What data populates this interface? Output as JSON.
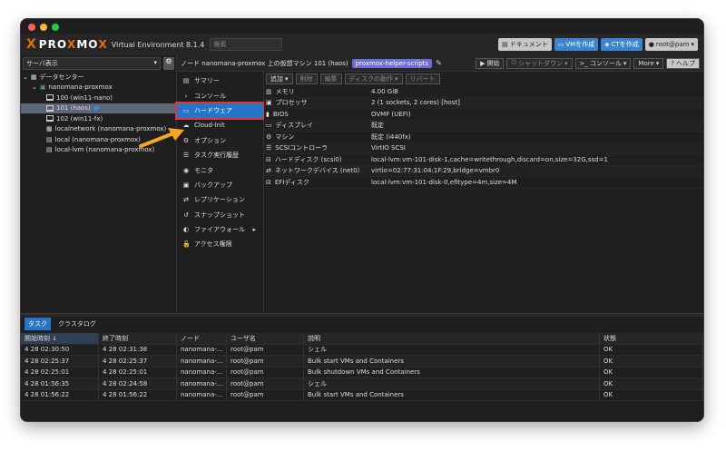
{
  "topbar": {
    "brand_x": "X",
    "brand_pro": "PRO",
    "brand_x2": "X",
    "brand_mo": "MO",
    "brand_x3": "X",
    "version": "Virtual Environment 8.1.4",
    "search_placeholder": "検索",
    "docs_label": "ドキュメント",
    "create_vm_label": "VMを作成",
    "create_ct_label": "CTを作成",
    "user_label": "root@pam"
  },
  "left": {
    "view_selector": "サーバ表示",
    "tree": [
      {
        "label": "データセンター"
      },
      {
        "label": "nanomana-proxmox"
      },
      {
        "label": "100 (win11-nano)"
      },
      {
        "label": "101 (haos)"
      },
      {
        "label": "102 (win11-fx)"
      },
      {
        "label": "localnetwork (nanomana-proxmox)"
      },
      {
        "label": "local (nanomana-proxmox)"
      },
      {
        "label": "local-lvm (nanomana-proxmox)"
      }
    ]
  },
  "crumbbar": {
    "title": "ノード nanomana-proxmox 上の仮想マシン 101 (haos)",
    "tag": "proxmox-helper-scripts",
    "start": "開始",
    "shutdown": "シャットダウン",
    "console": "コンソール",
    "more": "More",
    "help": "ヘルプ"
  },
  "menu": [
    {
      "label": "サマリー"
    },
    {
      "label": "コンソール"
    },
    {
      "label": "ハードウェア"
    },
    {
      "label": "Cloud-Init"
    },
    {
      "label": "オプション"
    },
    {
      "label": "タスク実行履歴"
    },
    {
      "label": "モニタ"
    },
    {
      "label": "バックアップ"
    },
    {
      "label": "レプリケーション"
    },
    {
      "label": "スナップショット"
    },
    {
      "label": "ファイアウォール"
    },
    {
      "label": "アクセス権限"
    }
  ],
  "toolbar": {
    "add": "追加",
    "remove": "削除",
    "edit": "編集",
    "disk_action": "ディスクの動作",
    "revert": "リバート"
  },
  "hardware": [
    {
      "key": "メモリ",
      "value": "4.00 GiB"
    },
    {
      "key": "プロセッサ",
      "value": "2 (1 sockets, 2 cores) [host]"
    },
    {
      "key": "BIOS",
      "value": "OVMF (UEFI)"
    },
    {
      "key": "ディスプレイ",
      "value": "既定"
    },
    {
      "key": "マシン",
      "value": "既定 (i440fx)"
    },
    {
      "key": "SCSIコントローラ",
      "value": "VirtIO SCSI"
    },
    {
      "key": "ハードディスク (scsi0)",
      "value": "local-lvm:vm-101-disk-1,cache=writethrough,discard=on,size=32G,ssd=1"
    },
    {
      "key": "ネットワークデバイス (net0)",
      "value": "virtio=02:77:31:04:1F:29,bridge=vmbr0"
    },
    {
      "key": "EFIディスク",
      "value": "local-lvm:vm-101-disk-0,efitype=4m,size=4M"
    }
  ],
  "bottom": {
    "tab_tasks": "タスク",
    "tab_cluster_log": "クラスタログ",
    "columns": [
      "開始時刻 ↓",
      "終了時刻",
      "ノード",
      "ユーザ名",
      "説明",
      "状態"
    ],
    "rows": [
      [
        "4 28 02:30:50",
        "4 28 02:31:38",
        "nanomana-...",
        "root@pam",
        "シェル",
        "OK"
      ],
      [
        "4 28 02:25:37",
        "4 28 02:25:37",
        "nanomana-...",
        "root@pam",
        "Bulk start VMs and Containers",
        "OK"
      ],
      [
        "4 28 02:25:01",
        "4 28 02:25:01",
        "nanomana-...",
        "root@pam",
        "Bulk shutdown VMs and Containers",
        "OK"
      ],
      [
        "4 28 01:56:35",
        "4 28 02:24:58",
        "nanomana-...",
        "root@pam",
        "シェル",
        "OK"
      ],
      [
        "4 28 01:56:22",
        "4 28 01:56:22",
        "nanomana-...",
        "root@pam",
        "Bulk start VMs and Containers",
        "OK"
      ]
    ]
  },
  "colors": {
    "accent": "#2775c9",
    "highlight": "#e8322b",
    "arrow": "#f5a623",
    "brand": "#e57000"
  }
}
